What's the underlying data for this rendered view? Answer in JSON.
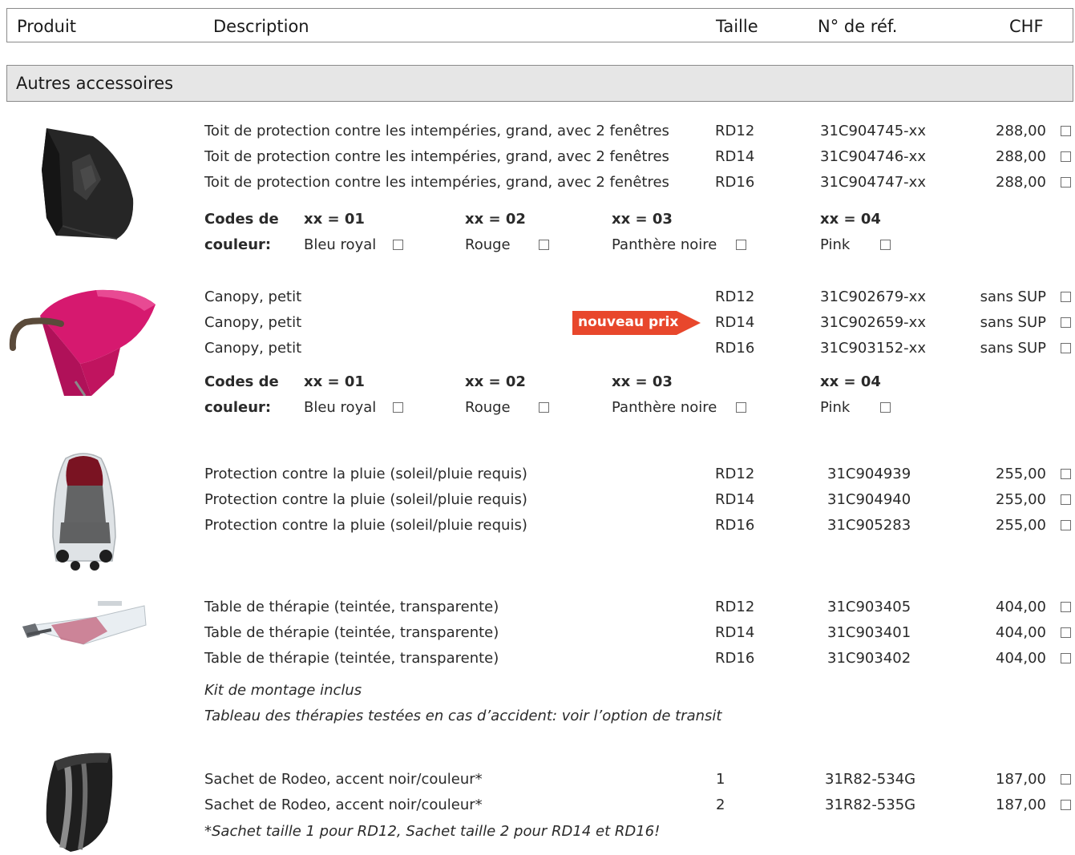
{
  "header": {
    "col_product": "Produit",
    "col_description": "Description",
    "col_size": "Taille",
    "col_ref": "N° de réf.",
    "col_price": "CHF"
  },
  "section": {
    "title": "Autres accessoires"
  },
  "colors": {
    "badge": "#e8472c",
    "section_bg": "#e6e6e6",
    "border": "#8a8a8a"
  },
  "groups": [
    {
      "image": "weather-roof-black",
      "rows": [
        {
          "desc": "Toit de protection contre les intempéries, grand, avec 2 fenêtres",
          "size": "RD12",
          "ref": "31C904745-xx",
          "price": "288,00"
        },
        {
          "desc": "Toit de protection contre les intempéries, grand, avec 2 fenêtres",
          "size": "RD14",
          "ref": "31C904746-xx",
          "price": "288,00"
        },
        {
          "desc": "Toit de protection contre les intempéries, grand, avec 2 fenêtres",
          "size": "RD16",
          "ref": "31C904747-xx",
          "price": "288,00"
        }
      ],
      "colors_label_1": "Codes de",
      "colors_label_2": "couleur:",
      "color_codes": [
        {
          "code": "xx = 01",
          "name": "Bleu royal"
        },
        {
          "code": "xx = 02",
          "name": "Rouge"
        },
        {
          "code": "xx = 03",
          "name": "Panthère noire"
        },
        {
          "code": "xx = 04",
          "name": "Pink"
        }
      ]
    },
    {
      "image": "canopy-pink",
      "badge": "nouveau prix",
      "rows": [
        {
          "desc": "Canopy, petit",
          "size": "RD12",
          "ref": "31C902679-xx",
          "price": "sans SUP"
        },
        {
          "desc": "Canopy, petit",
          "size": "RD14",
          "ref": "31C902659-xx",
          "price": "sans SUP"
        },
        {
          "desc": "Canopy, petit",
          "size": "RD16",
          "ref": "31C903152-xx",
          "price": "sans SUP"
        }
      ],
      "colors_label_1": "Codes de",
      "colors_label_2": "couleur:",
      "color_codes": [
        {
          "code": "xx = 01",
          "name": "Bleu royal"
        },
        {
          "code": "xx = 02",
          "name": "Rouge"
        },
        {
          "code": "xx = 03",
          "name": "Panthère noire"
        },
        {
          "code": "xx = 04",
          "name": "Pink"
        }
      ]
    },
    {
      "image": "rain-cover",
      "rows": [
        {
          "desc": "Protection contre la pluie (soleil/pluie requis)",
          "size": "RD12",
          "ref": "31C904939",
          "price": "255,00"
        },
        {
          "desc": "Protection contre la pluie (soleil/pluie requis)",
          "size": "RD14",
          "ref": "31C904940",
          "price": "255,00"
        },
        {
          "desc": "Protection contre la pluie (soleil/pluie requis)",
          "size": "RD16",
          "ref": "31C905283",
          "price": "255,00"
        }
      ]
    },
    {
      "image": "therapy-table",
      "rows": [
        {
          "desc": "Table de thérapie (teintée, transparente)",
          "size": "RD12",
          "ref": "31C903405",
          "price": "404,00"
        },
        {
          "desc": "Table de thérapie (teintée, transparente)",
          "size": "RD14",
          "ref": "31C903401",
          "price": "404,00"
        },
        {
          "desc": "Table de thérapie (teintée, transparente)",
          "size": "RD16",
          "ref": "31C903402",
          "price": "404,00"
        }
      ],
      "notes": [
        "Kit de montage inclus",
        "Tableau des thérapies testées en cas d’accident: voir l’option de transit"
      ]
    },
    {
      "image": "rodeo-bag",
      "rows": [
        {
          "desc": "Sachet de Rodeo, accent noir/couleur*",
          "size": "1",
          "ref": "31R82-534G",
          "price": "187,00"
        },
        {
          "desc": "Sachet de Rodeo, accent noir/couleur*",
          "size": "2",
          "ref": "31R82-535G",
          "price": "187,00"
        }
      ],
      "notes": [
        "*Sachet taille 1 pour RD12, Sachet taille 2 pour RD14 et RD16!"
      ]
    }
  ]
}
